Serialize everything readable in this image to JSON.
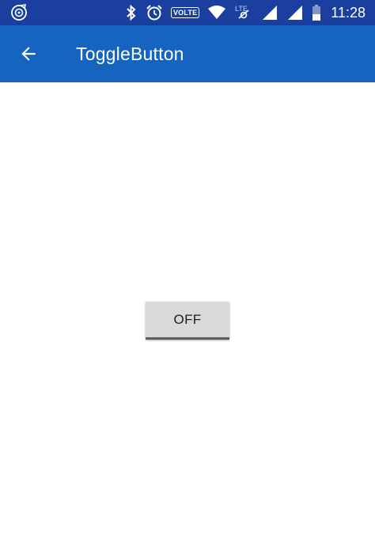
{
  "status_bar": {
    "time": "11:28",
    "volte_label": "VOLTE",
    "icons": [
      "app-notification-icon",
      "bluetooth-icon",
      "alarm-icon",
      "volte-badge",
      "wifi-icon",
      "lte-data-icon",
      "signal-icon",
      "signal-icon",
      "battery-icon"
    ]
  },
  "app_bar": {
    "title": "ToggleButton",
    "background": "#1565C0"
  },
  "toggle": {
    "label": "OFF",
    "state": false
  },
  "colors": {
    "status_bar": "#1A3F9E",
    "app_bar": "#1565C0",
    "button_bg": "#d9d9d9",
    "indicator_off": "#5f5f5f"
  }
}
